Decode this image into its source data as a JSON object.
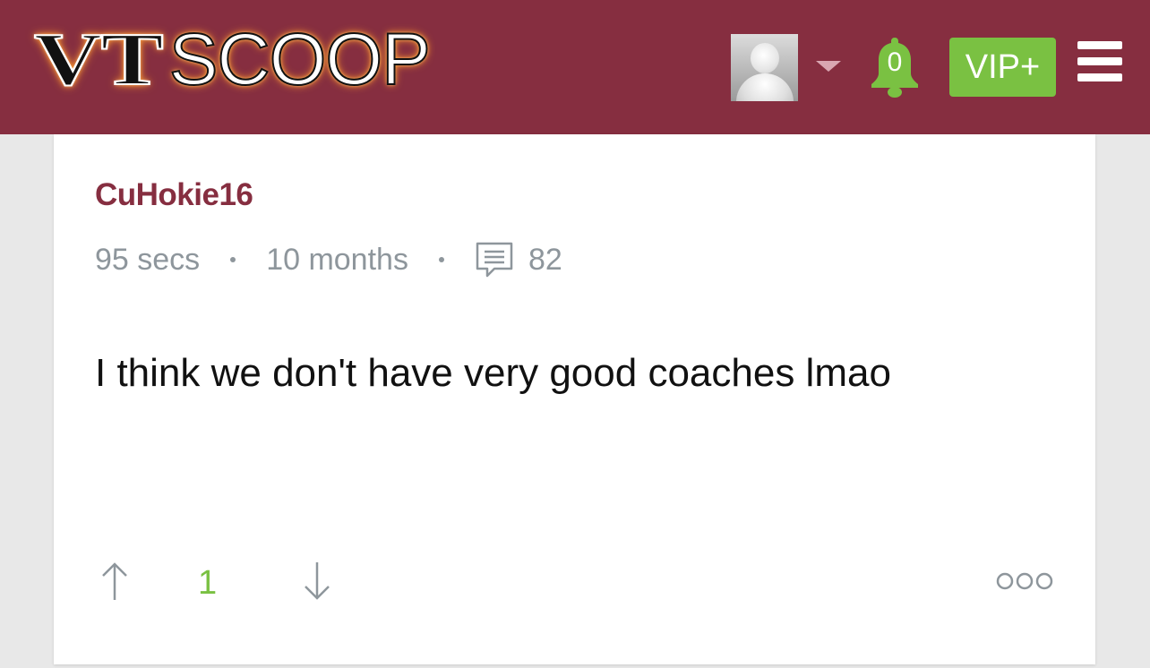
{
  "header": {
    "logo_part1": "VT",
    "logo_part2": "SCOOP",
    "notification_count": "0",
    "vip_label": "VIP+",
    "icons": [
      "avatar",
      "chevron-down-icon",
      "bell-icon",
      "hamburger-menu-icon"
    ]
  },
  "colors": {
    "brand": "#862e40",
    "accent_green": "#7ac142",
    "meta_gray": "#8e969c"
  },
  "post": {
    "username": "CuHokie16",
    "duration": "95 secs",
    "age": "10 months",
    "comment_count": "82",
    "body": "I think we don't have very good coaches lmao",
    "vote_count": "1"
  }
}
